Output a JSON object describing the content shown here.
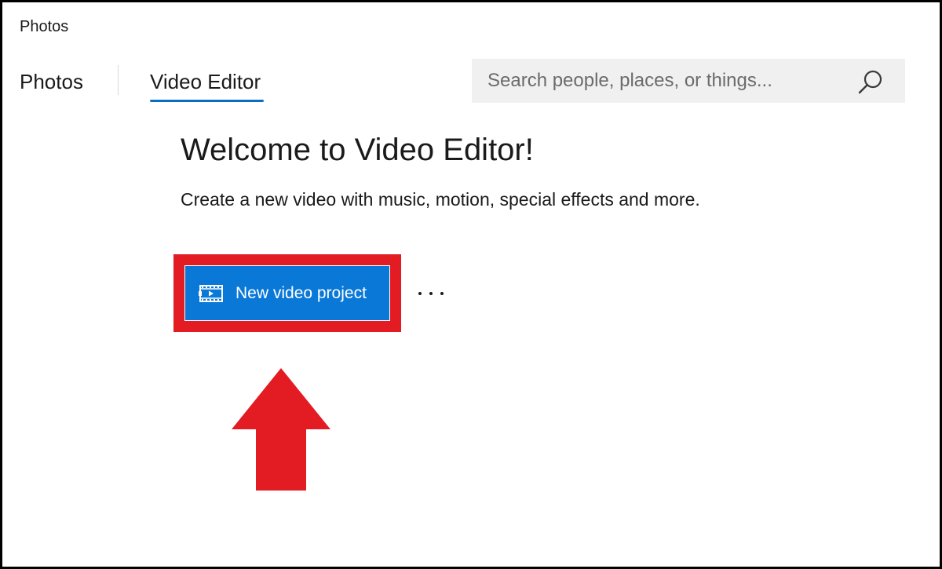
{
  "app": {
    "title": "Photos"
  },
  "tabs": [
    {
      "label": "Photos",
      "active": false
    },
    {
      "label": "Video Editor",
      "active": true
    }
  ],
  "search": {
    "placeholder": "Search people, places, or things...",
    "value": "",
    "icon": "search-icon"
  },
  "welcome": {
    "title": "Welcome to Video Editor!",
    "subtitle": "Create a new video with music, motion, special effects and more."
  },
  "actions": {
    "new_project_label": "New video project",
    "new_project_icon": "video-project-icon",
    "more_icon": "more-icon"
  },
  "colors": {
    "accent": "#0a78d7",
    "tab_underline": "#0a6fc4",
    "annotation": "#e31b23",
    "search_bg": "#f0f0f0"
  }
}
